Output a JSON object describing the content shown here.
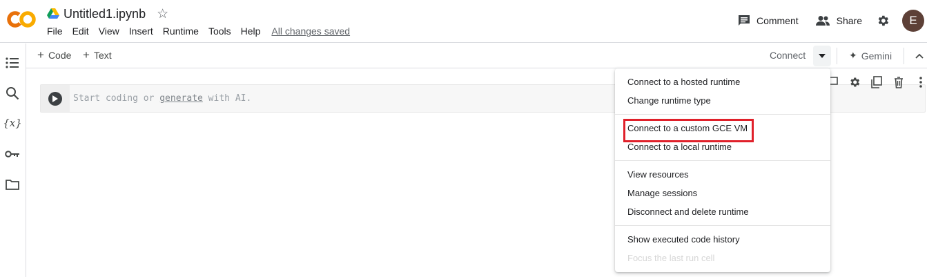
{
  "header": {
    "logo_text": "CO",
    "doc_title": "Untitled1.ipynb",
    "menu": [
      "File",
      "Edit",
      "View",
      "Insert",
      "Runtime",
      "Tools",
      "Help"
    ],
    "save_status": "All changes saved",
    "comment_label": "Comment",
    "share_label": "Share",
    "avatar_letter": "E",
    "icons": {
      "drive": "google-drive-icon",
      "star": "star-icon",
      "comment": "comment-icon",
      "share": "share-people-icon",
      "settings": "gear-icon"
    }
  },
  "sidebar": {
    "icons": [
      "table-of-contents-icon",
      "search-icon",
      "variables-icon",
      "key-icon",
      "folder-icon"
    ],
    "variables_glyph": "{x}"
  },
  "toolbar": {
    "add_code_label": "Code",
    "add_text_label": "Text",
    "connect_label": "Connect",
    "gemini_label": "Gemini"
  },
  "cell": {
    "placeholder_before": "Start coding or ",
    "placeholder_link": "generate",
    "placeholder_after": " with AI."
  },
  "runtime_menu": {
    "groups": [
      [
        "Connect to a hosted runtime",
        "Change runtime type"
      ],
      [
        "Connect to a custom GCE VM",
        "Connect to a local runtime"
      ],
      [
        "View resources",
        "Manage sessions",
        "Disconnect and delete runtime"
      ],
      [
        "Show executed code history",
        "Focus the last run cell"
      ]
    ],
    "highlighted_item": "Connect to a custom GCE VM",
    "disabled_item": "Focus the last run cell"
  },
  "colors": {
    "logo_orange": "#f9ab00",
    "logo_dark_orange": "#e8710a",
    "highlight_red": "#e0202a",
    "avatar_bg": "#5d4037"
  }
}
